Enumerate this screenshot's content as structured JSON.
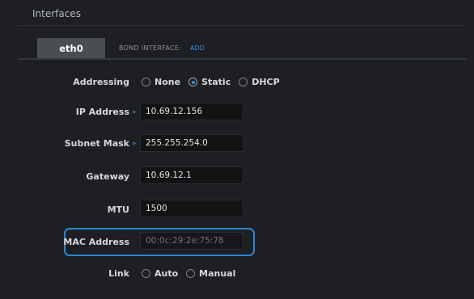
{
  "panel": {
    "title": "Interfaces"
  },
  "tabs": {
    "active": "eth0",
    "bond_label": "BOND INTERFACE:",
    "bond_add": "ADD"
  },
  "form": {
    "addressing": {
      "label": "Addressing",
      "options": [
        "None",
        "Static",
        "DHCP"
      ],
      "selected": "Static"
    },
    "ip": {
      "label": "IP Address",
      "required_mark": "»",
      "value": "10.69.12.156"
    },
    "subnet": {
      "label": "Subnet Mask",
      "required_mark": "»",
      "value": "255.255.254.0"
    },
    "gateway": {
      "label": "Gateway",
      "value": "10.69.12.1"
    },
    "mtu": {
      "label": "MTU",
      "value": "1500"
    },
    "mac": {
      "label": "MAC Address",
      "value": "00:0c:29:2e:75:78"
    },
    "link": {
      "label": "Link",
      "options": [
        "Auto",
        "Manual"
      ],
      "selected": ""
    }
  },
  "colors": {
    "accent": "#2b86d9",
    "background": "#1d1f22",
    "tab_active": "#4a4d52"
  }
}
